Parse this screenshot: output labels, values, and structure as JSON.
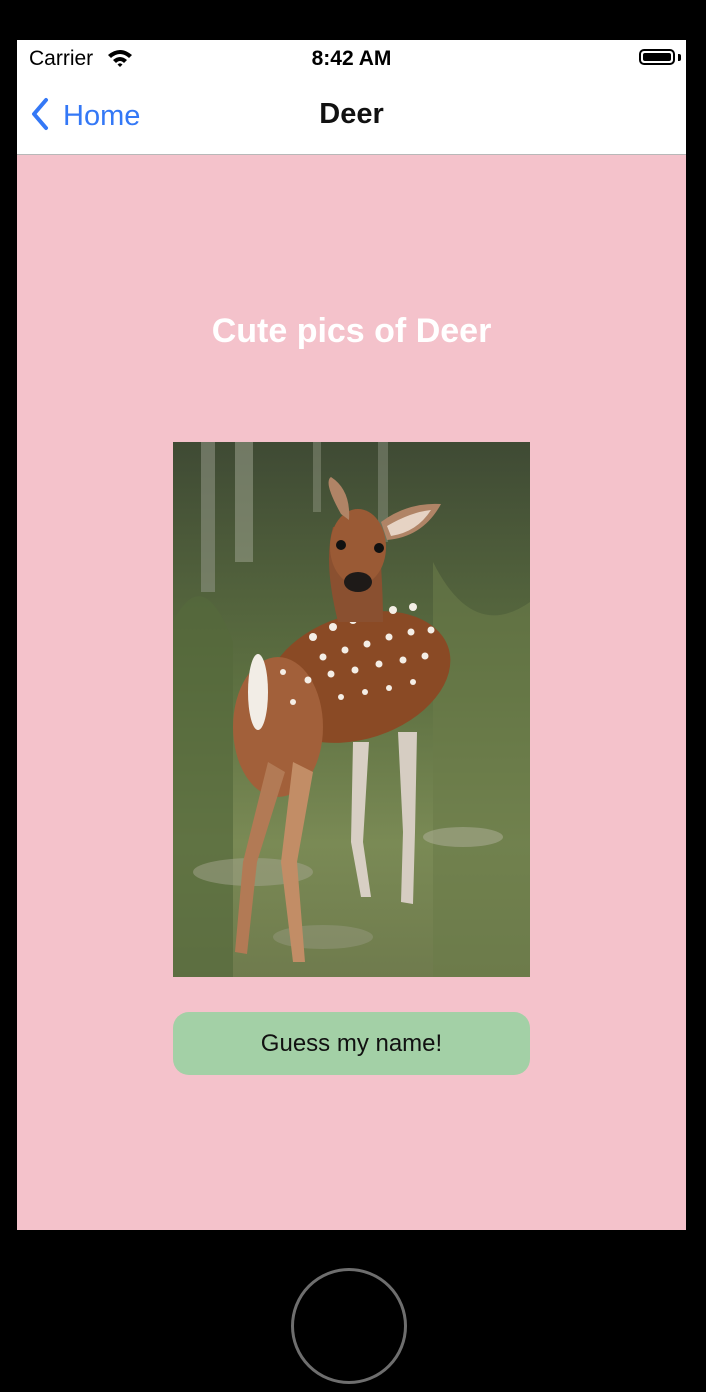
{
  "status_bar": {
    "carrier": "Carrier",
    "time": "8:42 AM",
    "wifi_icon": "wifi-icon",
    "battery_icon": "battery-full-icon",
    "battery_level": 1.0
  },
  "nav_bar": {
    "back_label": "Home",
    "back_icon": "chevron-left-icon",
    "title": "Deer"
  },
  "content": {
    "heading": "Cute pics of Deer",
    "photo_subject": "fawn-photo",
    "button_label": "Guess my name!"
  },
  "colors": {
    "background": "#f4c2cb",
    "accent": "#3478f6",
    "button": "#a3d0a6",
    "heading": "#ffffff"
  }
}
